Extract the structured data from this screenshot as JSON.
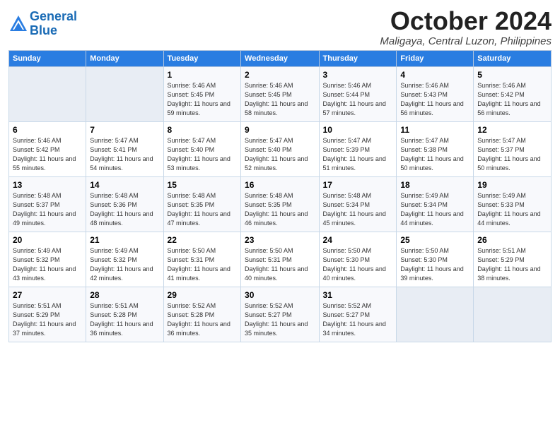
{
  "logo": {
    "line1": "General",
    "line2": "Blue"
  },
  "title": "October 2024",
  "location": "Maligaya, Central Luzon, Philippines",
  "days_of_week": [
    "Sunday",
    "Monday",
    "Tuesday",
    "Wednesday",
    "Thursday",
    "Friday",
    "Saturday"
  ],
  "weeks": [
    [
      {
        "day": "",
        "sunrise": "",
        "sunset": "",
        "daylight": ""
      },
      {
        "day": "",
        "sunrise": "",
        "sunset": "",
        "daylight": ""
      },
      {
        "day": "1",
        "sunrise": "Sunrise: 5:46 AM",
        "sunset": "Sunset: 5:45 PM",
        "daylight": "Daylight: 11 hours and 59 minutes."
      },
      {
        "day": "2",
        "sunrise": "Sunrise: 5:46 AM",
        "sunset": "Sunset: 5:45 PM",
        "daylight": "Daylight: 11 hours and 58 minutes."
      },
      {
        "day": "3",
        "sunrise": "Sunrise: 5:46 AM",
        "sunset": "Sunset: 5:44 PM",
        "daylight": "Daylight: 11 hours and 57 minutes."
      },
      {
        "day": "4",
        "sunrise": "Sunrise: 5:46 AM",
        "sunset": "Sunset: 5:43 PM",
        "daylight": "Daylight: 11 hours and 56 minutes."
      },
      {
        "day": "5",
        "sunrise": "Sunrise: 5:46 AM",
        "sunset": "Sunset: 5:42 PM",
        "daylight": "Daylight: 11 hours and 56 minutes."
      }
    ],
    [
      {
        "day": "6",
        "sunrise": "Sunrise: 5:46 AM",
        "sunset": "Sunset: 5:42 PM",
        "daylight": "Daylight: 11 hours and 55 minutes."
      },
      {
        "day": "7",
        "sunrise": "Sunrise: 5:47 AM",
        "sunset": "Sunset: 5:41 PM",
        "daylight": "Daylight: 11 hours and 54 minutes."
      },
      {
        "day": "8",
        "sunrise": "Sunrise: 5:47 AM",
        "sunset": "Sunset: 5:40 PM",
        "daylight": "Daylight: 11 hours and 53 minutes."
      },
      {
        "day": "9",
        "sunrise": "Sunrise: 5:47 AM",
        "sunset": "Sunset: 5:40 PM",
        "daylight": "Daylight: 11 hours and 52 minutes."
      },
      {
        "day": "10",
        "sunrise": "Sunrise: 5:47 AM",
        "sunset": "Sunset: 5:39 PM",
        "daylight": "Daylight: 11 hours and 51 minutes."
      },
      {
        "day": "11",
        "sunrise": "Sunrise: 5:47 AM",
        "sunset": "Sunset: 5:38 PM",
        "daylight": "Daylight: 11 hours and 50 minutes."
      },
      {
        "day": "12",
        "sunrise": "Sunrise: 5:47 AM",
        "sunset": "Sunset: 5:37 PM",
        "daylight": "Daylight: 11 hours and 50 minutes."
      }
    ],
    [
      {
        "day": "13",
        "sunrise": "Sunrise: 5:48 AM",
        "sunset": "Sunset: 5:37 PM",
        "daylight": "Daylight: 11 hours and 49 minutes."
      },
      {
        "day": "14",
        "sunrise": "Sunrise: 5:48 AM",
        "sunset": "Sunset: 5:36 PM",
        "daylight": "Daylight: 11 hours and 48 minutes."
      },
      {
        "day": "15",
        "sunrise": "Sunrise: 5:48 AM",
        "sunset": "Sunset: 5:35 PM",
        "daylight": "Daylight: 11 hours and 47 minutes."
      },
      {
        "day": "16",
        "sunrise": "Sunrise: 5:48 AM",
        "sunset": "Sunset: 5:35 PM",
        "daylight": "Daylight: 11 hours and 46 minutes."
      },
      {
        "day": "17",
        "sunrise": "Sunrise: 5:48 AM",
        "sunset": "Sunset: 5:34 PM",
        "daylight": "Daylight: 11 hours and 45 minutes."
      },
      {
        "day": "18",
        "sunrise": "Sunrise: 5:49 AM",
        "sunset": "Sunset: 5:34 PM",
        "daylight": "Daylight: 11 hours and 44 minutes."
      },
      {
        "day": "19",
        "sunrise": "Sunrise: 5:49 AM",
        "sunset": "Sunset: 5:33 PM",
        "daylight": "Daylight: 11 hours and 44 minutes."
      }
    ],
    [
      {
        "day": "20",
        "sunrise": "Sunrise: 5:49 AM",
        "sunset": "Sunset: 5:32 PM",
        "daylight": "Daylight: 11 hours and 43 minutes."
      },
      {
        "day": "21",
        "sunrise": "Sunrise: 5:49 AM",
        "sunset": "Sunset: 5:32 PM",
        "daylight": "Daylight: 11 hours and 42 minutes."
      },
      {
        "day": "22",
        "sunrise": "Sunrise: 5:50 AM",
        "sunset": "Sunset: 5:31 PM",
        "daylight": "Daylight: 11 hours and 41 minutes."
      },
      {
        "day": "23",
        "sunrise": "Sunrise: 5:50 AM",
        "sunset": "Sunset: 5:31 PM",
        "daylight": "Daylight: 11 hours and 40 minutes."
      },
      {
        "day": "24",
        "sunrise": "Sunrise: 5:50 AM",
        "sunset": "Sunset: 5:30 PM",
        "daylight": "Daylight: 11 hours and 40 minutes."
      },
      {
        "day": "25",
        "sunrise": "Sunrise: 5:50 AM",
        "sunset": "Sunset: 5:30 PM",
        "daylight": "Daylight: 11 hours and 39 minutes."
      },
      {
        "day": "26",
        "sunrise": "Sunrise: 5:51 AM",
        "sunset": "Sunset: 5:29 PM",
        "daylight": "Daylight: 11 hours and 38 minutes."
      }
    ],
    [
      {
        "day": "27",
        "sunrise": "Sunrise: 5:51 AM",
        "sunset": "Sunset: 5:29 PM",
        "daylight": "Daylight: 11 hours and 37 minutes."
      },
      {
        "day": "28",
        "sunrise": "Sunrise: 5:51 AM",
        "sunset": "Sunset: 5:28 PM",
        "daylight": "Daylight: 11 hours and 36 minutes."
      },
      {
        "day": "29",
        "sunrise": "Sunrise: 5:52 AM",
        "sunset": "Sunset: 5:28 PM",
        "daylight": "Daylight: 11 hours and 36 minutes."
      },
      {
        "day": "30",
        "sunrise": "Sunrise: 5:52 AM",
        "sunset": "Sunset: 5:27 PM",
        "daylight": "Daylight: 11 hours and 35 minutes."
      },
      {
        "day": "31",
        "sunrise": "Sunrise: 5:52 AM",
        "sunset": "Sunset: 5:27 PM",
        "daylight": "Daylight: 11 hours and 34 minutes."
      },
      {
        "day": "",
        "sunrise": "",
        "sunset": "",
        "daylight": ""
      },
      {
        "day": "",
        "sunrise": "",
        "sunset": "",
        "daylight": ""
      }
    ]
  ]
}
